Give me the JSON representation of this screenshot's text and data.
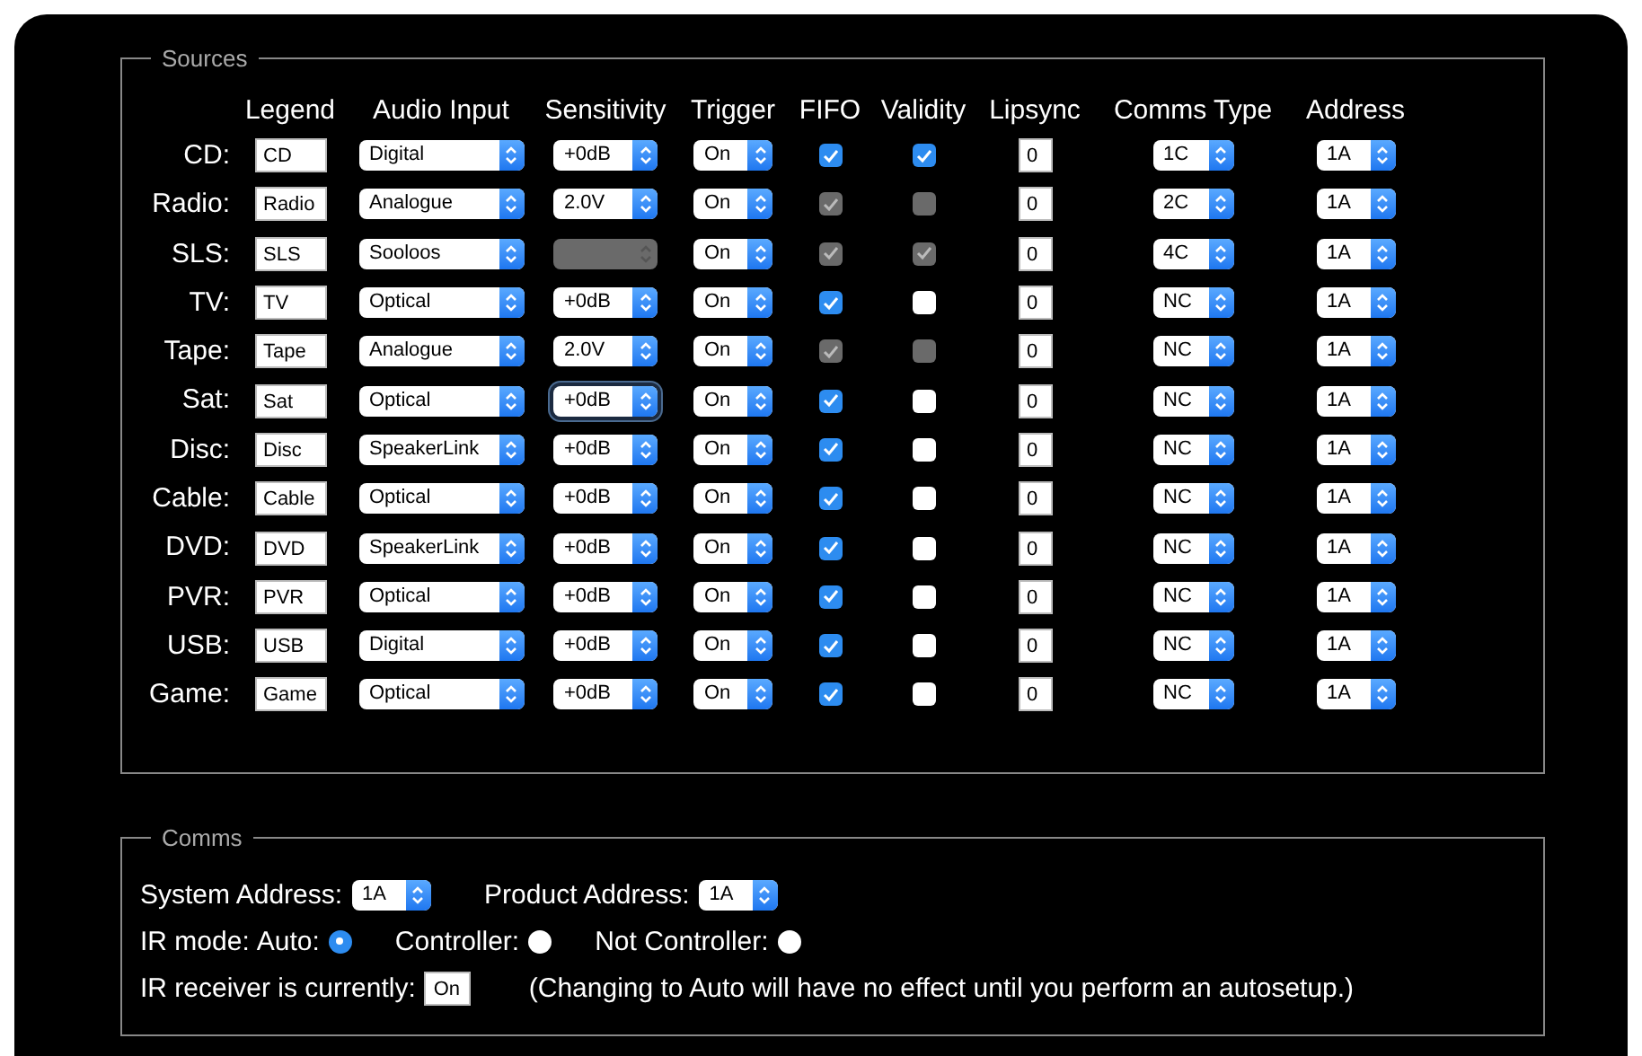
{
  "sources": {
    "legend": "Sources",
    "columns": [
      "Legend",
      "Audio Input",
      "Sensitivity",
      "Trigger",
      "FIFO",
      "Validity",
      "Lipsync",
      "Comms Type",
      "Address"
    ],
    "rows": [
      {
        "label": "CD:",
        "legend": "CD",
        "audio_input": "Digital",
        "sensitivity": {
          "value": "+0dB",
          "disabled": false,
          "focused": false
        },
        "trigger": "On",
        "fifo": {
          "checked": true,
          "disabled": false
        },
        "validity": {
          "checked": true,
          "disabled": false
        },
        "lipsync": "0",
        "comms_type": "1C",
        "address": "1A"
      },
      {
        "label": "Radio:",
        "legend": "Radio",
        "audio_input": "Analogue",
        "sensitivity": {
          "value": "2.0V",
          "disabled": false,
          "focused": false
        },
        "trigger": "On",
        "fifo": {
          "checked": true,
          "disabled": true
        },
        "validity": {
          "checked": false,
          "disabled": true
        },
        "lipsync": "0",
        "comms_type": "2C",
        "address": "1A"
      },
      {
        "label": "SLS:",
        "legend": "SLS",
        "audio_input": "Sooloos",
        "sensitivity": {
          "disabled": true,
          "focused": false
        },
        "trigger": "On",
        "fifo": {
          "checked": true,
          "disabled": true
        },
        "validity": {
          "checked": true,
          "disabled": true
        },
        "lipsync": "0",
        "comms_type": "4C",
        "address": "1A"
      },
      {
        "label": "TV:",
        "legend": "TV",
        "audio_input": "Optical",
        "sensitivity": {
          "value": "+0dB",
          "disabled": false,
          "focused": false
        },
        "trigger": "On",
        "fifo": {
          "checked": true,
          "disabled": false
        },
        "validity": {
          "checked": false,
          "disabled": false
        },
        "lipsync": "0",
        "comms_type": "NC",
        "address": "1A"
      },
      {
        "label": "Tape:",
        "legend": "Tape",
        "audio_input": "Analogue",
        "sensitivity": {
          "value": "2.0V",
          "disabled": false,
          "focused": false
        },
        "trigger": "On",
        "fifo": {
          "checked": true,
          "disabled": true
        },
        "validity": {
          "checked": false,
          "disabled": true
        },
        "lipsync": "0",
        "comms_type": "NC",
        "address": "1A"
      },
      {
        "label": "Sat:",
        "legend": "Sat",
        "audio_input": "Optical",
        "sensitivity": {
          "value": "+0dB",
          "disabled": false,
          "focused": true
        },
        "trigger": "On",
        "fifo": {
          "checked": true,
          "disabled": false
        },
        "validity": {
          "checked": false,
          "disabled": false
        },
        "lipsync": "0",
        "comms_type": "NC",
        "address": "1A"
      },
      {
        "label": "Disc:",
        "legend": "Disc",
        "audio_input": "SpeakerLink",
        "sensitivity": {
          "value": "+0dB",
          "disabled": false,
          "focused": false
        },
        "trigger": "On",
        "fifo": {
          "checked": true,
          "disabled": false
        },
        "validity": {
          "checked": false,
          "disabled": false
        },
        "lipsync": "0",
        "comms_type": "NC",
        "address": "1A"
      },
      {
        "label": "Cable:",
        "legend": "Cable",
        "audio_input": "Optical",
        "sensitivity": {
          "value": "+0dB",
          "disabled": false,
          "focused": false
        },
        "trigger": "On",
        "fifo": {
          "checked": true,
          "disabled": false
        },
        "validity": {
          "checked": false,
          "disabled": false
        },
        "lipsync": "0",
        "comms_type": "NC",
        "address": "1A"
      },
      {
        "label": "DVD:",
        "legend": "DVD",
        "audio_input": "SpeakerLink",
        "sensitivity": {
          "value": "+0dB",
          "disabled": false,
          "focused": false
        },
        "trigger": "On",
        "fifo": {
          "checked": true,
          "disabled": false
        },
        "validity": {
          "checked": false,
          "disabled": false
        },
        "lipsync": "0",
        "comms_type": "NC",
        "address": "1A"
      },
      {
        "label": "PVR:",
        "legend": "PVR",
        "audio_input": "Optical",
        "sensitivity": {
          "value": "+0dB",
          "disabled": false,
          "focused": false
        },
        "trigger": "On",
        "fifo": {
          "checked": true,
          "disabled": false
        },
        "validity": {
          "checked": false,
          "disabled": false
        },
        "lipsync": "0",
        "comms_type": "NC",
        "address": "1A"
      },
      {
        "label": "USB:",
        "legend": "USB",
        "audio_input": "Digital",
        "sensitivity": {
          "value": "+0dB",
          "disabled": false,
          "focused": false
        },
        "trigger": "On",
        "fifo": {
          "checked": true,
          "disabled": false
        },
        "validity": {
          "checked": false,
          "disabled": false
        },
        "lipsync": "0",
        "comms_type": "NC",
        "address": "1A"
      },
      {
        "label": "Game:",
        "legend": "Game",
        "audio_input": "Optical",
        "sensitivity": {
          "value": "+0dB",
          "disabled": false,
          "focused": false
        },
        "trigger": "On",
        "fifo": {
          "checked": true,
          "disabled": false
        },
        "validity": {
          "checked": false,
          "disabled": false
        },
        "lipsync": "0",
        "comms_type": "NC",
        "address": "1A"
      }
    ]
  },
  "comms": {
    "legend": "Comms",
    "system_address_label": "System Address:",
    "system_address": "1A",
    "product_address_label": "Product Address:",
    "product_address": "1A",
    "ir_mode_label": "IR mode:",
    "ir_mode_options": [
      {
        "label": "Auto:",
        "selected": true
      },
      {
        "label": "Controller:",
        "selected": false
      },
      {
        "label": "Not Controller:",
        "selected": false
      }
    ],
    "ir_receiver_label": "IR receiver is currently:",
    "ir_receiver": "On",
    "note": "(Changing to Auto will have no effect until you perform an autosetup.)"
  }
}
